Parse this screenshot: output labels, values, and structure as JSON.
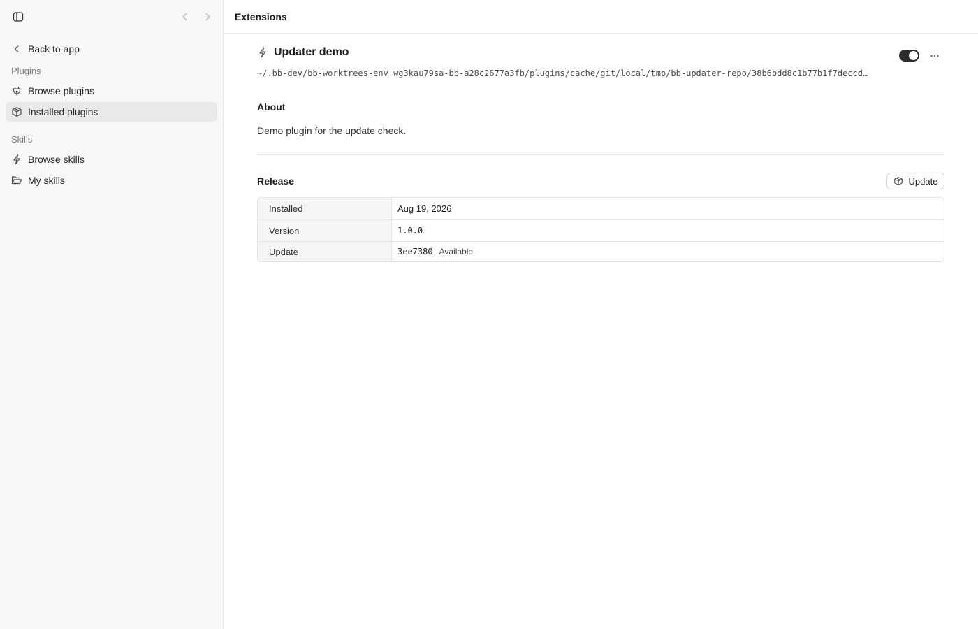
{
  "sidebar": {
    "back_label": "Back to app",
    "sections": {
      "plugins_label": "Plugins",
      "skills_label": "Skills"
    },
    "items": {
      "browse_plugins": "Browse plugins",
      "installed_plugins": "Installed plugins",
      "browse_skills": "Browse skills",
      "my_skills": "My skills"
    },
    "active_item": "installed_plugins"
  },
  "header": {
    "title": "Extensions"
  },
  "plugin": {
    "title": "Updater demo",
    "enabled": true,
    "path": "~/.bb-dev/bb-worktrees-env_wg3kau79sa-bb-a28c2677a3fb/plugins/cache/git/local/tmp/bb-updater-repo/38b6bdd8c1b77b1f7deccd…",
    "about_heading": "About",
    "about_text": "Demo plugin for the update check."
  },
  "release": {
    "heading": "Release",
    "update_button": "Update",
    "rows": {
      "installed_label": "Installed",
      "installed_value": "Aug 19, 2026",
      "version_label": "Version",
      "version_value": "1.0.0",
      "update_label": "Update",
      "update_hash": "3ee7380",
      "update_status": "Available"
    }
  },
  "icons": {
    "sidebar_toggle": "sidebar-toggle-icon",
    "nav_back": "chevron-left-icon",
    "nav_forward": "chevron-right-icon",
    "back": "chevron-left-icon",
    "browse_plugins": "plug-icon",
    "installed_plugins": "package-icon",
    "browse_skills": "bolt-icon",
    "my_skills": "folder-icon",
    "plugin": "bolt-icon",
    "more": "ellipsis-icon",
    "update": "package-icon"
  },
  "colors": {
    "sidebar_bg": "#f7f7f7",
    "active_bg": "#e9e9e9",
    "toggle_on": "#2b2b2b"
  }
}
